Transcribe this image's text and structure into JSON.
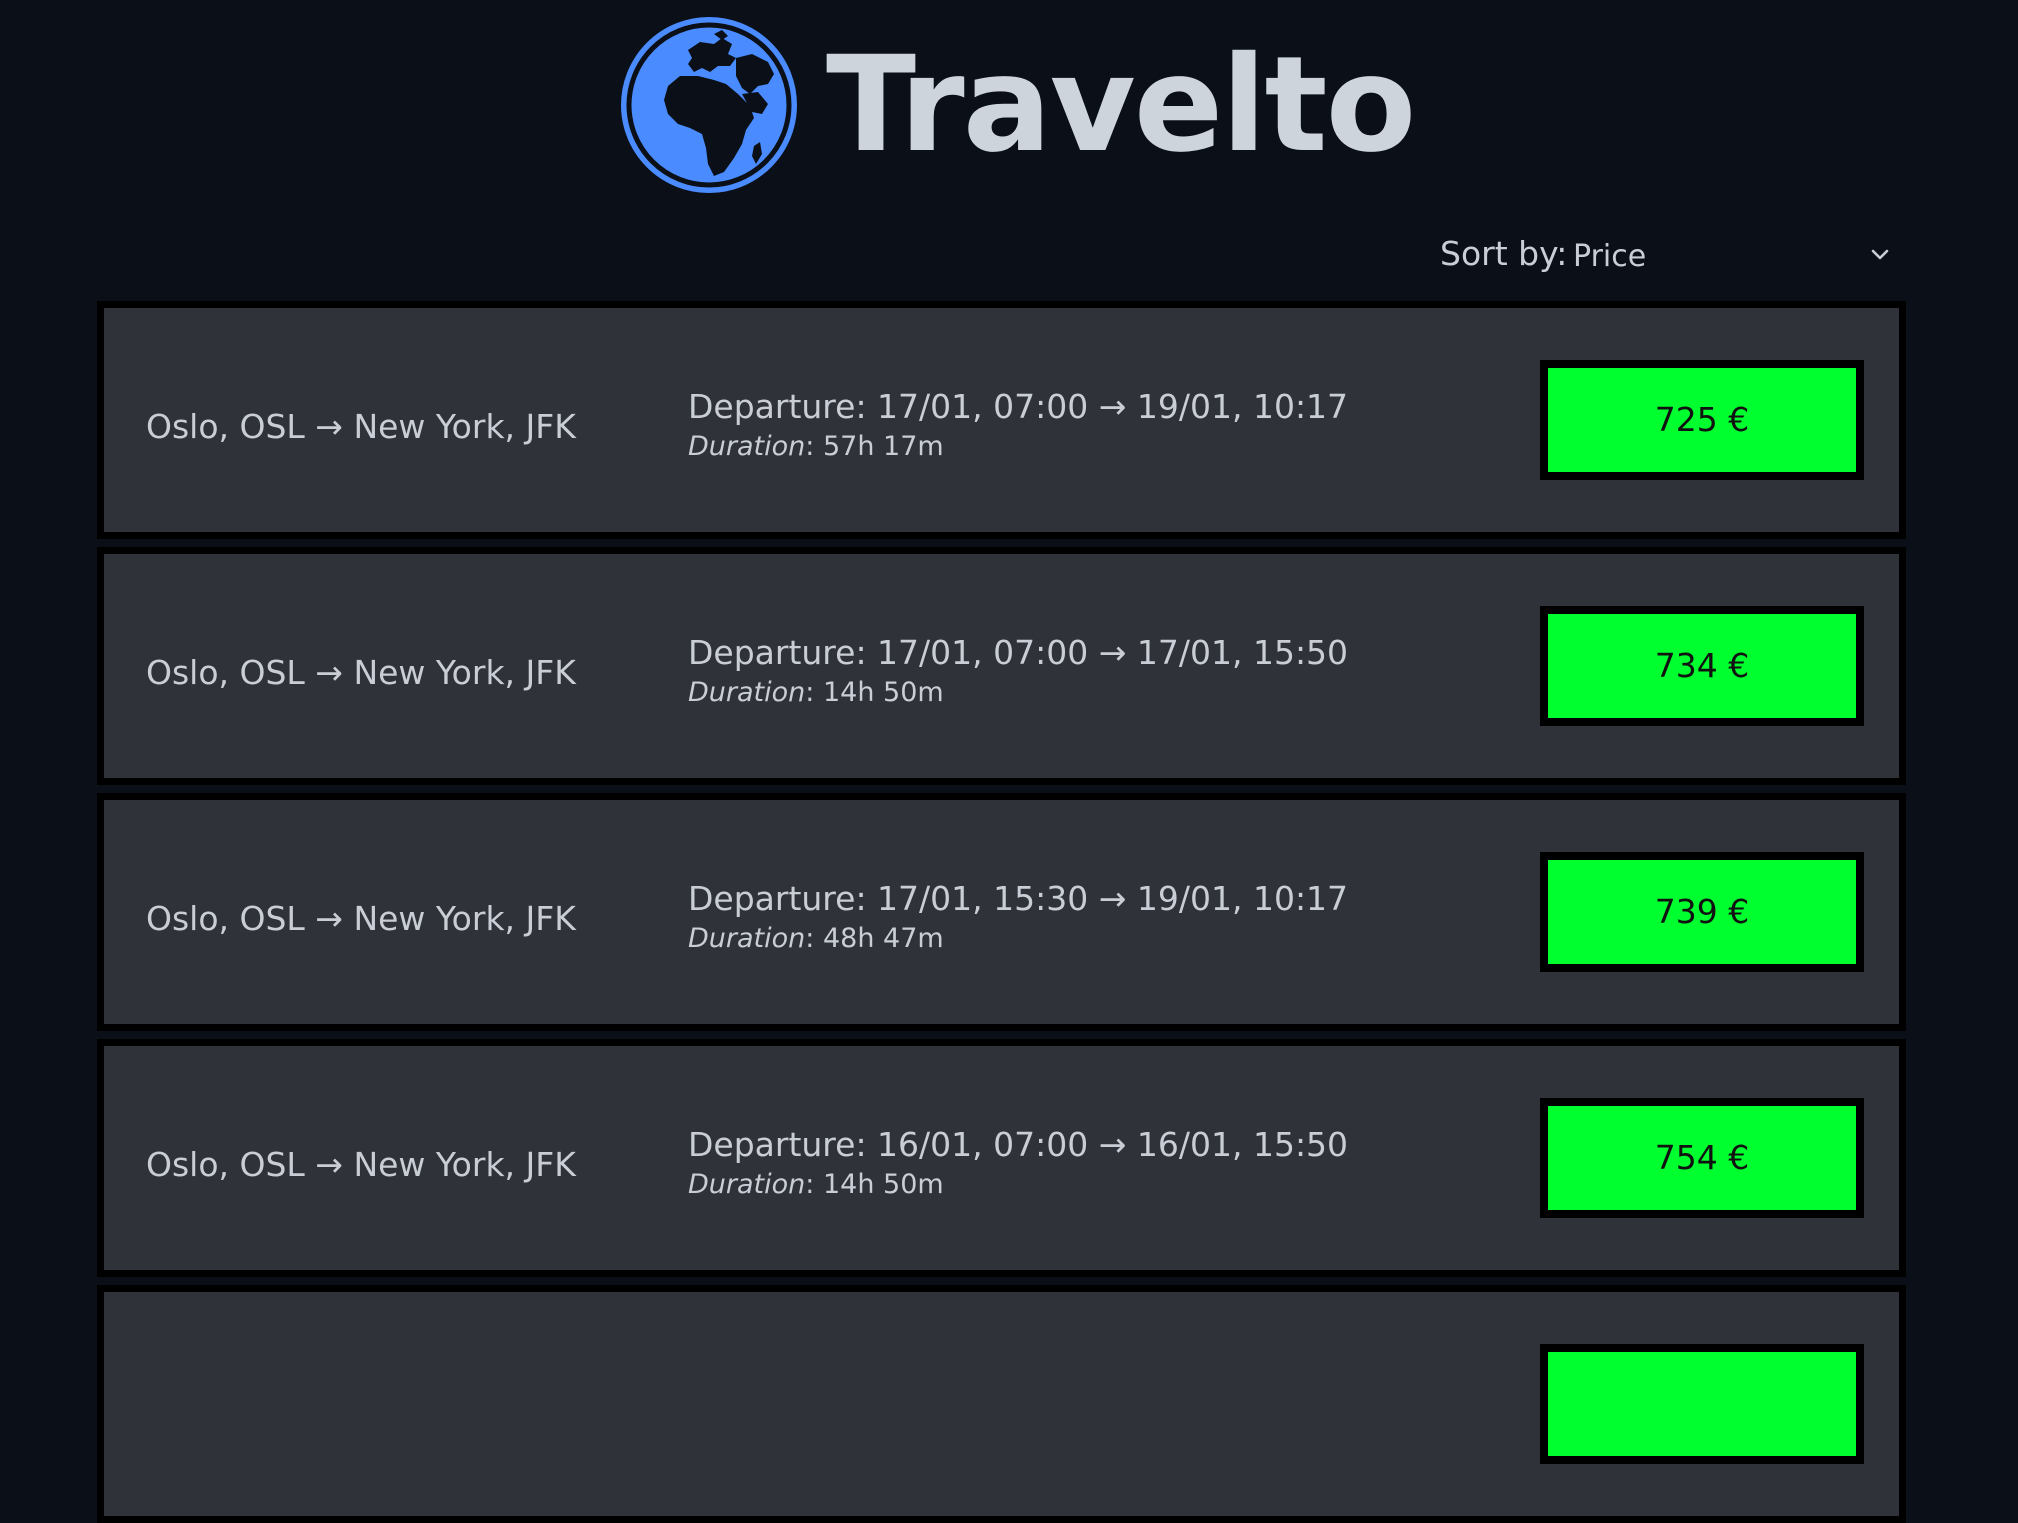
{
  "header": {
    "logo_icon": "globe-icon",
    "brand": "Travelto",
    "brand_color": "#ced4dc",
    "globe_color": "#4a8cff"
  },
  "sort": {
    "label": "Sort by:",
    "value": "Price",
    "icon": "chevron-down-icon"
  },
  "colors": {
    "background": "#0b0f17",
    "card": "#2f3238",
    "price_button": "#00ff2e"
  },
  "flights": [
    {
      "route": "Oslo, OSL → New York, JFK",
      "departure": "Departure: 17/01, 07:00 → 19/01, 10:17",
      "duration_label": "Duration",
      "duration_value": ": 57h 17m",
      "price": "725 €"
    },
    {
      "route": "Oslo, OSL → New York, JFK",
      "departure": "Departure: 17/01, 07:00 → 17/01, 15:50",
      "duration_label": "Duration",
      "duration_value": ": 14h 50m",
      "price": "734 €"
    },
    {
      "route": "Oslo, OSL → New York, JFK",
      "departure": "Departure: 17/01, 15:30 → 19/01, 10:17",
      "duration_label": "Duration",
      "duration_value": ": 48h 47m",
      "price": "739 €"
    },
    {
      "route": "Oslo, OSL → New York, JFK",
      "departure": "Departure: 16/01, 07:00 → 16/01, 15:50",
      "duration_label": "Duration",
      "duration_value": ": 14h 50m",
      "price": "754 €"
    },
    {
      "route": "",
      "departure": "",
      "duration_label": "",
      "duration_value": "",
      "price": ""
    }
  ]
}
